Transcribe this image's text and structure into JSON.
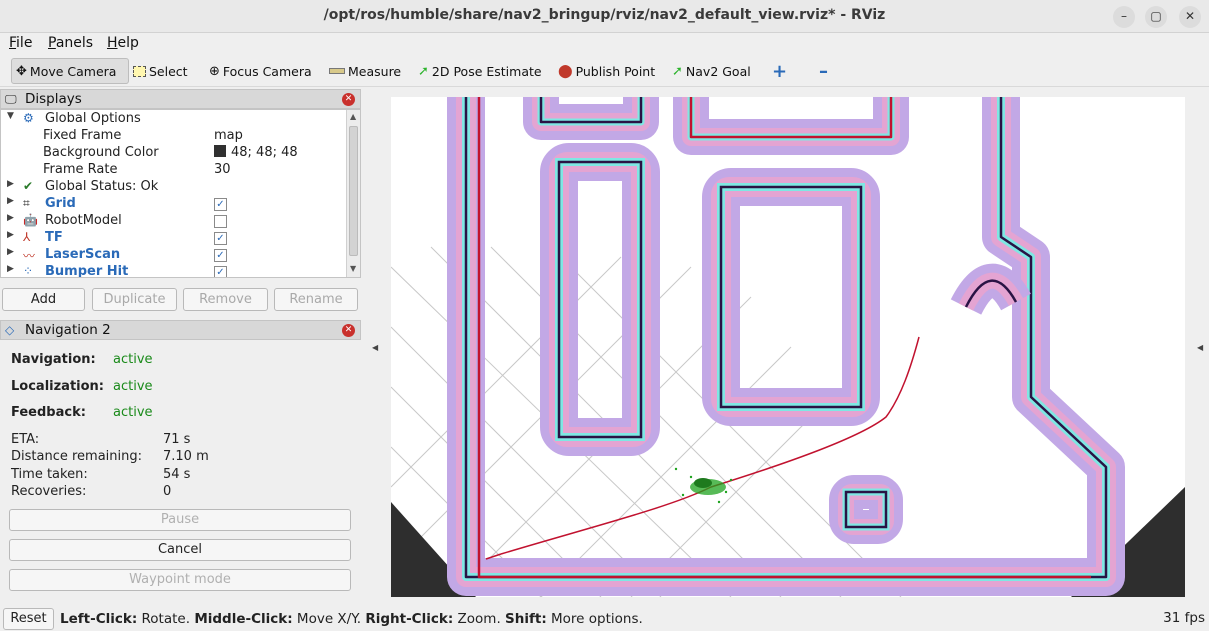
{
  "window": {
    "title": "/opt/ros/humble/share/nav2_bringup/rviz/nav2_default_view.rviz* - RViz",
    "minimize_glyph": "–",
    "maximize_glyph": "▢",
    "close_glyph": "✕"
  },
  "menu": {
    "file_rest": "ile",
    "file_key": "F",
    "panels_key": "P",
    "panels_rest": "anels",
    "help_key": "H",
    "help_rest": "elp"
  },
  "toolbar": {
    "move_camera": "Move Camera",
    "select": "Select",
    "focus_camera": "Focus Camera",
    "measure": "Measure",
    "pose_estimate": "2D Pose Estimate",
    "publish_point": "Publish Point",
    "nav2_goal": "Nav2 Goal"
  },
  "displays": {
    "title": "Displays",
    "global_options": "Global Options",
    "fixed_frame_label": "Fixed Frame",
    "fixed_frame_value": "map",
    "bg_color_label": "Background Color",
    "bg_color_value": "48; 48; 48",
    "frame_rate_label": "Frame Rate",
    "frame_rate_value": "30",
    "global_status": "Global Status: Ok",
    "grid": "Grid",
    "robot_model": "RobotModel",
    "tf": "TF",
    "laser_scan": "LaserScan",
    "bumper_hit": "Bumper Hit",
    "grid_checked": true,
    "robot_model_checked": false,
    "tf_checked": true,
    "laser_scan_checked": true,
    "bumper_hit_checked": true
  },
  "display_buttons": {
    "add": "Add",
    "duplicate": "Duplicate",
    "remove": "Remove",
    "rename": "Rename"
  },
  "navigation": {
    "title": "Navigation 2",
    "navigation_label": "Navigation:",
    "navigation_value": "active",
    "localization_label": "Localization:",
    "localization_value": "active",
    "feedback_label": "Feedback:",
    "feedback_value": "active",
    "eta_label": "ETA:",
    "eta_value": "71 s",
    "distance_label": "Distance remaining:",
    "distance_value": "7.10 m",
    "time_label": "Time taken:",
    "time_value": "54 s",
    "recoveries_label": "Recoveries:",
    "recoveries_value": "0",
    "pause": "Pause",
    "cancel": "Cancel",
    "waypoint_mode": "Waypoint mode"
  },
  "status": {
    "reset": "Reset",
    "left_click_label": "Left-Click:",
    "left_click_text": " Rotate. ",
    "middle_click_label": "Middle-Click:",
    "middle_click_text": " Move X/Y. ",
    "right_click_label": "Right-Click:",
    "right_click_text": " Zoom. ",
    "shift_label": "Shift:",
    "shift_text": " More options.",
    "fps": "31 fps"
  },
  "colors": {
    "costmap_outer": "#c2a8e6",
    "costmap_mid": "#e4a4d2",
    "inflation": "#7fe7e3",
    "wall": "#2a1344",
    "accent_red": "#c1122f",
    "active_green": "#1a8a1a"
  }
}
